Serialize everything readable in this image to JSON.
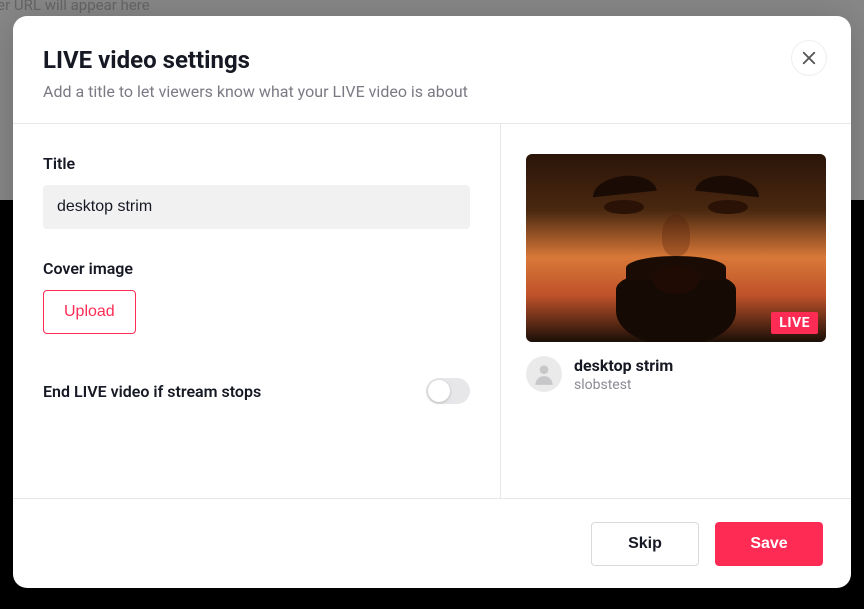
{
  "backdrop_text": "ver URL will appear here",
  "modal": {
    "title": "LIVE video settings",
    "subtitle": "Add a title to let viewers know what your LIVE video is about"
  },
  "form": {
    "title_label": "Title",
    "title_value": "desktop strim",
    "cover_label": "Cover image",
    "upload_label": "Upload",
    "end_toggle_label": "End LIVE video if stream stops",
    "end_toggle_on": false
  },
  "preview": {
    "live_badge": "LIVE",
    "stream_title": "desktop strim",
    "username": "slobstest"
  },
  "footer": {
    "skip": "Skip",
    "save": "Save"
  }
}
